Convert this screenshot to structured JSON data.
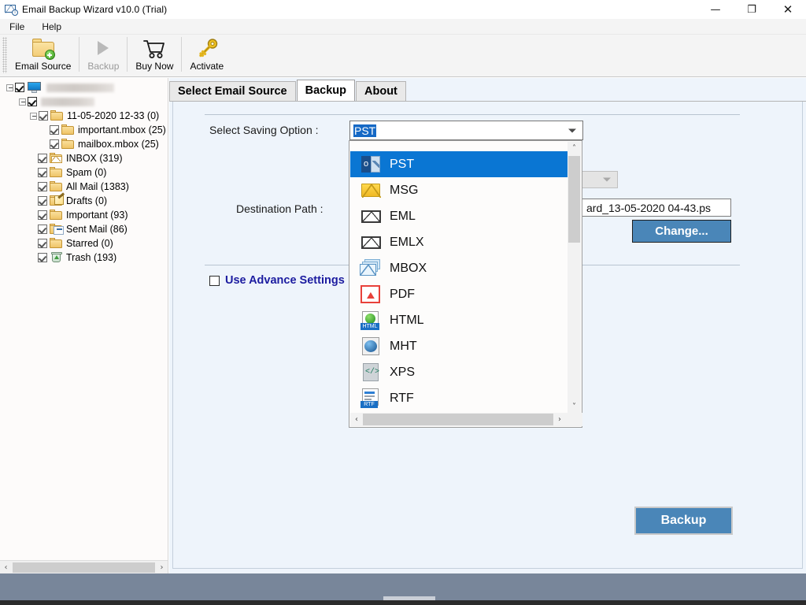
{
  "window": {
    "title": "Email Backup Wizard v10.0 (Trial)",
    "app_icon": "mail-wizard-icon",
    "minimize": "—",
    "maximize": "❐",
    "close": "✕"
  },
  "menubar": {
    "items": [
      {
        "label": "File"
      },
      {
        "label": "Help"
      }
    ]
  },
  "toolbar": {
    "buttons": [
      {
        "label": "Email Source",
        "icon": "folder-add-icon",
        "enabled": true
      },
      {
        "label": "Backup",
        "icon": "play-icon",
        "enabled": false
      },
      {
        "label": "Buy Now",
        "icon": "shopping-cart-icon",
        "enabled": true
      },
      {
        "label": "Activate",
        "icon": "key-icon",
        "enabled": true
      }
    ]
  },
  "tree": {
    "nodes": [
      {
        "label": "",
        "redacted": true,
        "redact_width": 86,
        "icon": "monitor-icon",
        "indent": 0,
        "expander": "minus",
        "checked": true
      },
      {
        "label": "",
        "redacted": true,
        "redact_width": 68,
        "icon": "none",
        "indent": 1,
        "expander": "minus",
        "checked": true
      },
      {
        "label": "11-05-2020 12-33 (0)",
        "icon": "folder-icon",
        "indent": 2,
        "expander": "minus",
        "checked": true
      },
      {
        "label": "important.mbox (25)",
        "icon": "folder-icon",
        "indent": 3,
        "expander": "none",
        "checked": true
      },
      {
        "label": "mailbox.mbox (25)",
        "icon": "folder-icon",
        "indent": 3,
        "expander": "none",
        "checked": true
      },
      {
        "label": "INBOX (319)",
        "icon": "folder-mail-icon",
        "indent": 2,
        "expander": "none",
        "checked": true
      },
      {
        "label": "Spam (0)",
        "icon": "folder-icon",
        "indent": 2,
        "expander": "none",
        "checked": true
      },
      {
        "label": "All Mail (1383)",
        "icon": "folder-icon",
        "indent": 2,
        "expander": "none",
        "checked": true
      },
      {
        "label": "Drafts (0)",
        "icon": "folder-draft-icon",
        "indent": 2,
        "expander": "none",
        "checked": true
      },
      {
        "label": "Important (93)",
        "icon": "folder-icon",
        "indent": 2,
        "expander": "none",
        "checked": true
      },
      {
        "label": "Sent Mail (86)",
        "icon": "folder-sent-icon",
        "indent": 2,
        "expander": "none",
        "checked": true
      },
      {
        "label": "Starred (0)",
        "icon": "folder-icon",
        "indent": 2,
        "expander": "none",
        "checked": true
      },
      {
        "label": "Trash (193)",
        "icon": "trash-icon",
        "indent": 2,
        "expander": "none",
        "checked": true
      }
    ],
    "hscroll": {
      "left_arrow": "‹",
      "right_arrow": "›"
    }
  },
  "tabs": [
    {
      "label": "Select Email Source",
      "active": false
    },
    {
      "label": "Backup",
      "active": true
    },
    {
      "label": "About",
      "active": false
    }
  ],
  "backup_tab": {
    "saving_option_label": "Select Saving Option :",
    "saving_option_value": "PST",
    "destination_path_label": "Destination Path :",
    "destination_path_value": "ard_13-05-2020 04-43.ps",
    "change_button": "Change...",
    "advance_settings_label": "Use Advance Settings",
    "advance_settings_checked": false,
    "backup_button": "Backup"
  },
  "dropdown": {
    "open": true,
    "selected": "PST",
    "options": [
      {
        "label": "PST",
        "icon": "pst-icon",
        "selected": true
      },
      {
        "label": "MSG",
        "icon": "msg-icon",
        "selected": false
      },
      {
        "label": "EML",
        "icon": "eml-icon",
        "selected": false
      },
      {
        "label": "EMLX",
        "icon": "emlx-icon",
        "selected": false
      },
      {
        "label": "MBOX",
        "icon": "mbox-icon",
        "selected": false
      },
      {
        "label": "PDF",
        "icon": "pdf-icon",
        "selected": false
      },
      {
        "label": "HTML",
        "icon": "html-icon",
        "selected": false
      },
      {
        "label": "MHT",
        "icon": "mht-icon",
        "selected": false
      },
      {
        "label": "XPS",
        "icon": "xps-icon",
        "selected": false
      },
      {
        "label": "RTF",
        "icon": "rtf-icon",
        "selected": false
      }
    ],
    "vscroll": {
      "up_arrow": "˄",
      "down_arrow": "˅"
    },
    "hscroll": {
      "left_arrow": "‹",
      "right_arrow": "›"
    }
  },
  "colors": {
    "accent_blue": "#0a76d3",
    "button_blue": "#4a86b8",
    "panel_bg": "#eef4fb",
    "statusbar": "#78869a",
    "advance_text": "#1c1ca0"
  }
}
